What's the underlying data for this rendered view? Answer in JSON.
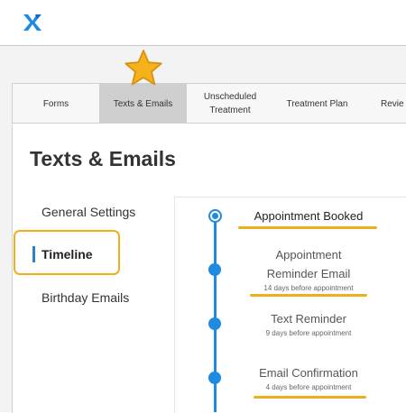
{
  "tabs": [
    {
      "label": "Forms",
      "active": false
    },
    {
      "label": "Texts & Emails",
      "active": true
    },
    {
      "label": "Unscheduled Treatment",
      "active": false
    },
    {
      "label": "Treatment Plan",
      "active": false
    },
    {
      "label": "Revie",
      "active": false
    }
  ],
  "page_title": "Texts & Emails",
  "nav": {
    "general_settings": "General Settings",
    "timeline": "Timeline",
    "birthday_emails": "Birthday Emails",
    "active_item": "Timeline"
  },
  "timeline": {
    "booked": {
      "title": "Appointment Booked"
    },
    "reminder_email": {
      "title_line1": "Appointment",
      "title_line2": "Reminder Email",
      "sub": "14 days before appointment"
    },
    "text_reminder": {
      "title": "Text Reminder",
      "sub": "9 days before appointment"
    },
    "email_confirmation": {
      "title": "Email Confirmation",
      "sub": "4 days before appointment"
    }
  },
  "colors": {
    "accent": "#1f8be0",
    "highlight": "#f0ad1c",
    "logo_blue": "#1e88e5"
  },
  "icons": {
    "logo": "x-logo-icon",
    "star": "star-icon"
  }
}
